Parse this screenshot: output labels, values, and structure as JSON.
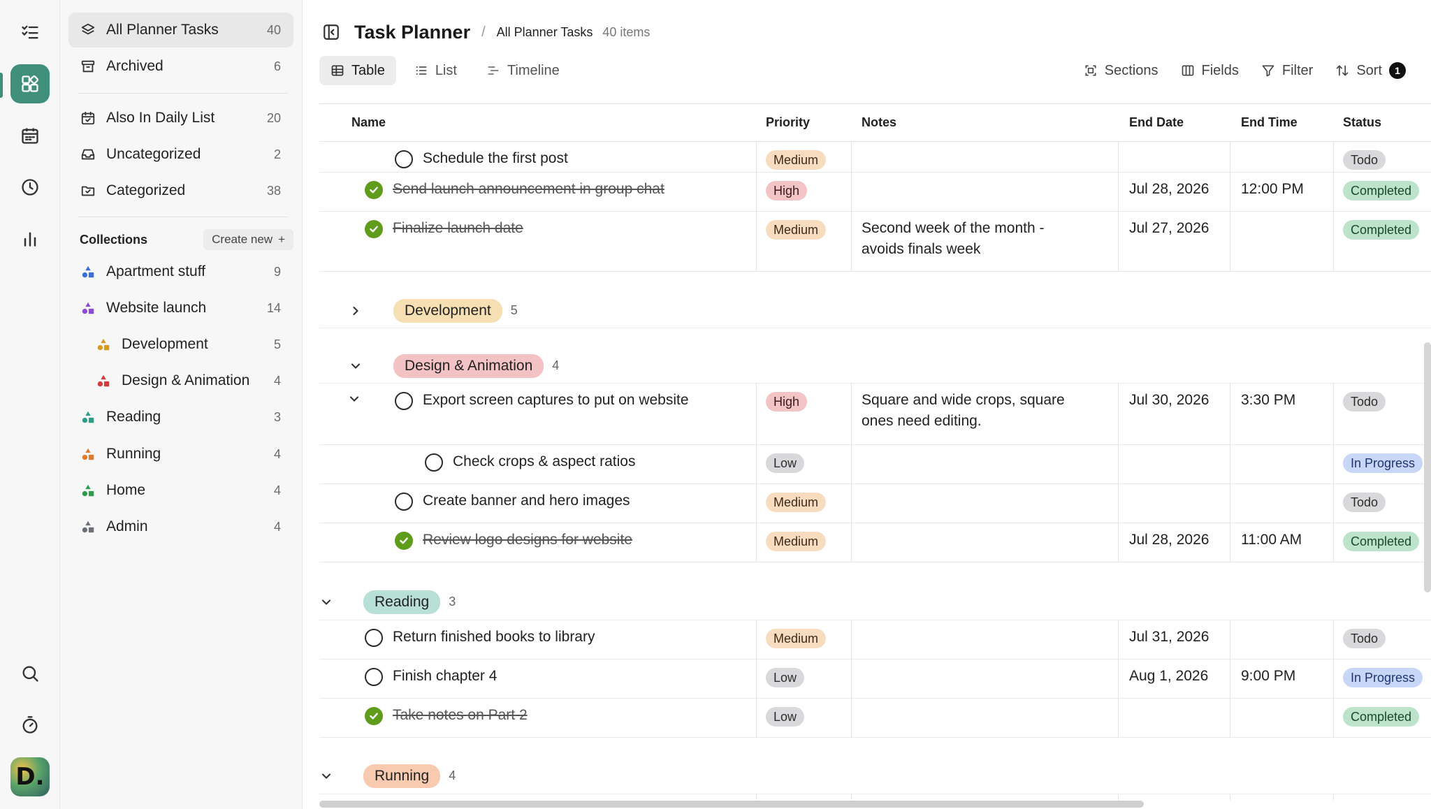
{
  "app": {
    "title": "Task Planner",
    "breadcrumb": "All Planner Tasks",
    "item_count": "40 items"
  },
  "sidebar": {
    "top_items": [
      {
        "label": "All Planner Tasks",
        "count": "40",
        "icon": "layers-icon"
      },
      {
        "label": "Archived",
        "count": "6",
        "icon": "archive-icon"
      }
    ],
    "filter_items": [
      {
        "label": "Also In Daily List",
        "count": "20",
        "icon": "calendar-check-icon"
      },
      {
        "label": "Uncategorized",
        "count": "2",
        "icon": "inbox-icon"
      },
      {
        "label": "Categorized",
        "count": "38",
        "icon": "folder-icon"
      }
    ],
    "collections_label": "Collections",
    "create_new_label": "Create new",
    "collections": [
      {
        "label": "Apartment stuff",
        "count": "9",
        "color": "#3b6fd6"
      },
      {
        "label": "Website launch",
        "count": "14",
        "color": "#8b4bd6"
      },
      {
        "label": "Development",
        "count": "5",
        "color": "#d69b1e"
      },
      {
        "label": "Design & Animation",
        "count": "4",
        "color": "#d63b3b"
      },
      {
        "label": "Reading",
        "count": "3",
        "color": "#2e9c86"
      },
      {
        "label": "Running",
        "count": "4",
        "color": "#e07a2e"
      },
      {
        "label": "Home",
        "count": "4",
        "color": "#2f9c4a"
      },
      {
        "label": "Admin",
        "count": "4",
        "color": "#6b6f78"
      }
    ]
  },
  "views": {
    "tabs": [
      "Table",
      "List",
      "Timeline"
    ],
    "active": "Table"
  },
  "toolbar": {
    "sections": "Sections",
    "fields": "Fields",
    "filter": "Filter",
    "sort": "Sort",
    "sort_count": "1"
  },
  "columns": [
    "Name",
    "Priority",
    "Notes",
    "End Date",
    "End Time",
    "Status"
  ],
  "rows": [
    {
      "name": "Schedule the first post",
      "priority": "Medium",
      "notes": "",
      "end_date": "",
      "end_time": "",
      "status": "Todo",
      "done": false
    },
    {
      "name": "Send launch announcement in group chat",
      "priority": "High",
      "notes": "",
      "end_date": "Jul 28, 2026",
      "end_time": "12:00 PM",
      "status": "Completed",
      "done": true
    },
    {
      "name": "Finalize launch date",
      "priority": "Medium",
      "notes": "Second week of the month - avoids finals week",
      "end_date": "Jul 27, 2026",
      "end_time": "",
      "status": "Completed",
      "done": true
    }
  ],
  "sections": {
    "development": {
      "label": "Development",
      "count": "5",
      "color": "#f5dfb3"
    },
    "design": {
      "label": "Design & Animation",
      "count": "4",
      "color": "#f3c2c4"
    },
    "reading": {
      "label": "Reading",
      "count": "3",
      "color": "#b9e0d6"
    },
    "running": {
      "label": "Running",
      "count": "4",
      "color": "#f8cbb0"
    }
  },
  "design_rows": [
    {
      "name": "Export screen captures to put on website",
      "priority": "High",
      "notes": "Square and wide crops, square ones need editing.",
      "end_date": "Jul 30, 2026",
      "end_time": "3:30 PM",
      "status": "Todo",
      "done": false
    },
    {
      "name": "Check crops & aspect ratios",
      "priority": "Low",
      "notes": "",
      "end_date": "",
      "end_time": "",
      "status": "In Progress",
      "done": false
    },
    {
      "name": "Create banner and hero images",
      "priority": "Medium",
      "notes": "",
      "end_date": "",
      "end_time": "",
      "status": "Todo",
      "done": false
    },
    {
      "name": "Review logo designs for website",
      "priority": "Medium",
      "notes": "",
      "end_date": "Jul 28, 2026",
      "end_time": "11:00 AM",
      "status": "Completed",
      "done": true
    }
  ],
  "reading_rows": [
    {
      "name": "Return finished books to library",
      "priority": "Medium",
      "notes": "",
      "end_date": "Jul 31, 2026",
      "end_time": "",
      "status": "Todo",
      "done": false
    },
    {
      "name": "Finish chapter 4",
      "priority": "Low",
      "notes": "",
      "end_date": "Aug 1, 2026",
      "end_time": "9:00 PM",
      "status": "In Progress",
      "done": false
    },
    {
      "name": "Take notes on Part 2",
      "priority": "Low",
      "notes": "",
      "end_date": "",
      "end_time": "",
      "status": "Completed",
      "done": true
    }
  ],
  "avatar_letter": "D."
}
